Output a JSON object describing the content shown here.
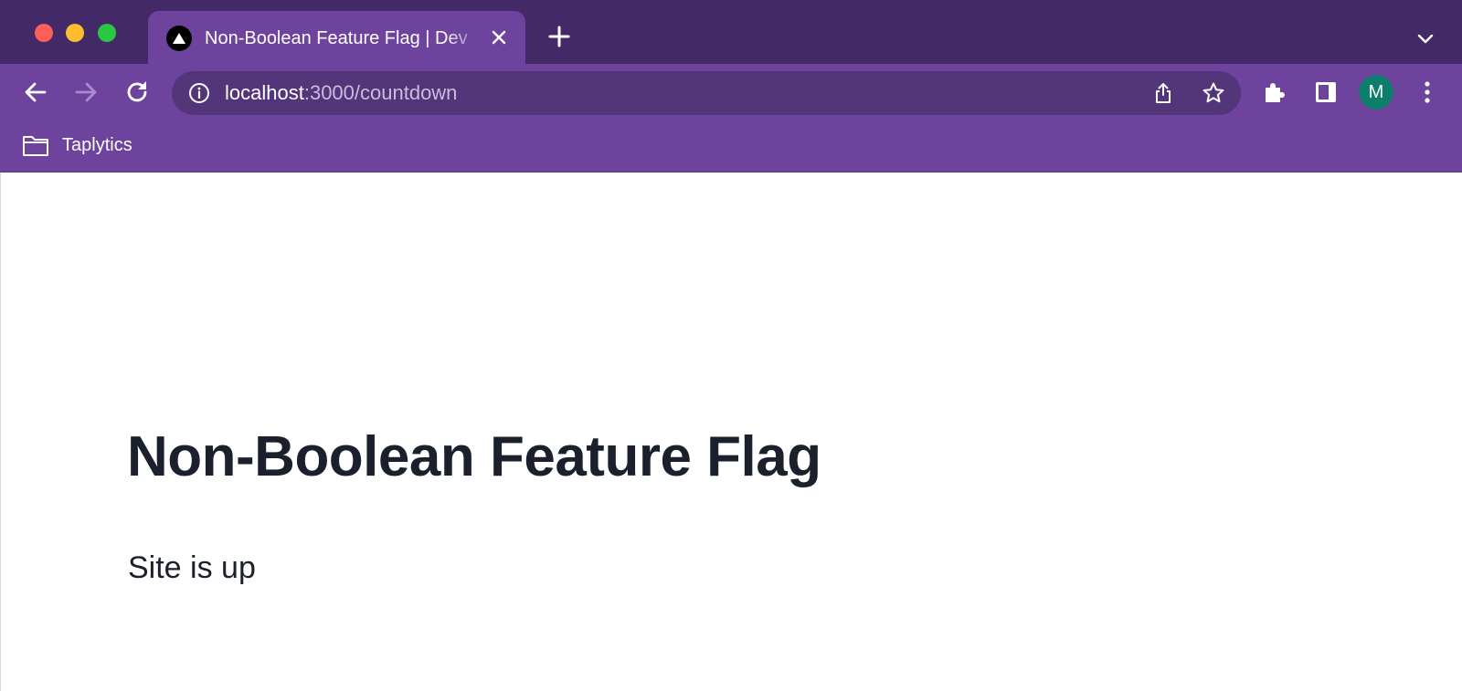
{
  "browser": {
    "tab": {
      "title": "Non-Boolean Feature Flag | Dev",
      "favicon": "vercel-triangle-icon"
    },
    "address_bar": {
      "host": "localhost",
      "path": ":3000/countdown"
    },
    "profile": {
      "initial": "M",
      "color": "#0d7d6c"
    },
    "bookmarks": [
      {
        "label": "Taplytics",
        "icon": "folder-icon"
      }
    ],
    "colors": {
      "frame": "#432968",
      "toolbar": "#6e439d",
      "omnibox": "#53357a"
    }
  },
  "page": {
    "heading": "Non-Boolean Feature Flag",
    "status": "Site is up"
  }
}
